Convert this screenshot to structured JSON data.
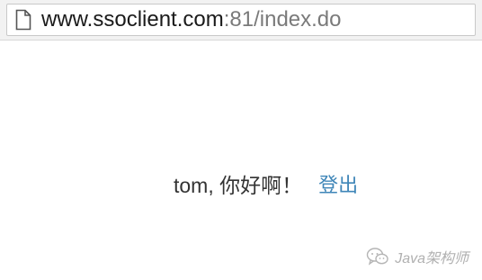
{
  "address_bar": {
    "url_host": "www.ssoclient.com",
    "url_rest": ":81/index.do",
    "page_icon": "page-icon"
  },
  "main": {
    "greeting": "tom, 你好啊！",
    "logout_label": "登出"
  },
  "watermark": {
    "icon": "wechat-icon",
    "text": "Java架构师"
  },
  "colors": {
    "link": "#3f86b8",
    "text": "#333333",
    "url_dim": "#7a7a7a"
  }
}
